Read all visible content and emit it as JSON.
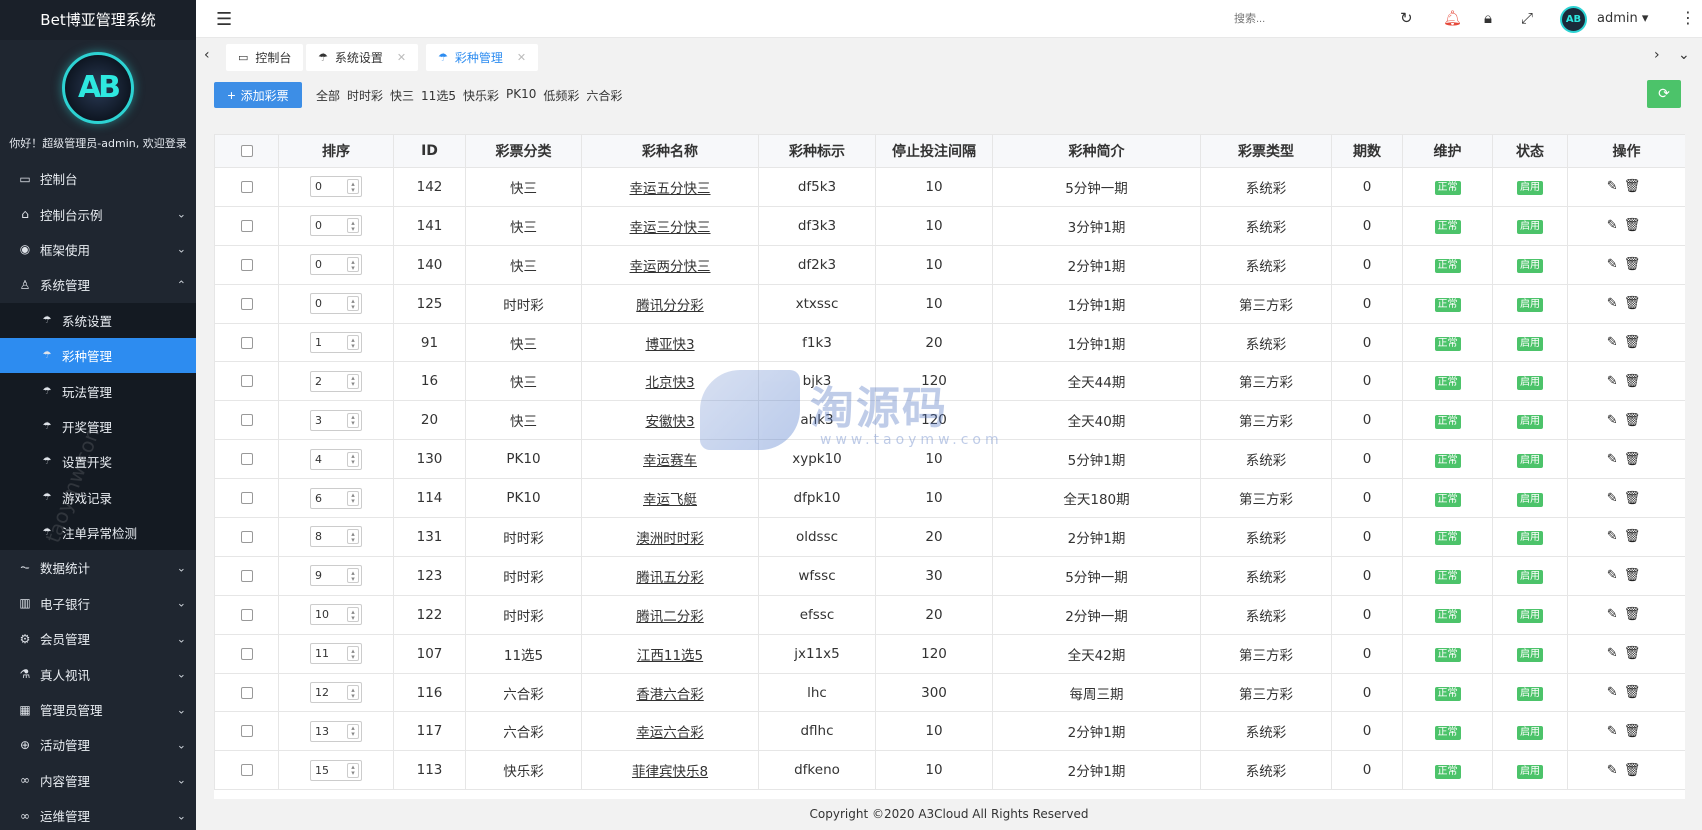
{
  "app": {
    "title": "Bet博亚管理系统",
    "welcome": "你好！超级管理员-admin, 欢迎登录",
    "logo_text": "AB"
  },
  "sidebar": {
    "items": [
      {
        "label": "控制台",
        "icon": "monitor-icon",
        "glyph": "▭",
        "chevron": "",
        "sub": false,
        "active": false
      },
      {
        "label": "控制台示例",
        "icon": "home-icon",
        "glyph": "⌂",
        "chevron": "⌄",
        "sub": false,
        "active": false
      },
      {
        "label": "框架使用",
        "icon": "badge-icon",
        "glyph": "◉",
        "chevron": "⌄",
        "sub": false,
        "active": false
      },
      {
        "label": "系统管理",
        "icon": "user-icon",
        "glyph": "♙",
        "chevron": "⌃",
        "sub": false,
        "active": false
      },
      {
        "label": "系统设置",
        "icon": "umbrella-icon",
        "glyph": "☂",
        "chevron": "",
        "sub": true,
        "active": false
      },
      {
        "label": "彩种管理",
        "icon": "umbrella-icon",
        "glyph": "☂",
        "chevron": "",
        "sub": true,
        "active": true
      },
      {
        "label": "玩法管理",
        "icon": "umbrella-icon",
        "glyph": "☂",
        "chevron": "",
        "sub": true,
        "active": false
      },
      {
        "label": "开奖管理",
        "icon": "umbrella-icon",
        "glyph": "☂",
        "chevron": "",
        "sub": true,
        "active": false
      },
      {
        "label": "设置开奖",
        "icon": "umbrella-icon",
        "glyph": "☂",
        "chevron": "",
        "sub": true,
        "active": false
      },
      {
        "label": "游戏记录",
        "icon": "umbrella-icon",
        "glyph": "☂",
        "chevron": "",
        "sub": true,
        "active": false
      },
      {
        "label": "注单异常检测",
        "icon": "umbrella-icon",
        "glyph": "☂",
        "chevron": "",
        "sub": true,
        "active": false
      },
      {
        "label": "数据统计",
        "icon": "chart-icon",
        "glyph": "⏦",
        "chevron": "⌄",
        "sub": false,
        "active": false
      },
      {
        "label": "电子银行",
        "icon": "book-icon",
        "glyph": "▥",
        "chevron": "⌄",
        "sub": false,
        "active": false
      },
      {
        "label": "会员管理",
        "icon": "gear-icon",
        "glyph": "⚙",
        "chevron": "⌄",
        "sub": false,
        "active": false
      },
      {
        "label": "真人视讯",
        "icon": "flask-icon",
        "glyph": "⚗",
        "chevron": "⌄",
        "sub": false,
        "active": false
      },
      {
        "label": "管理员管理",
        "icon": "grid-icon",
        "glyph": "▦",
        "chevron": "⌄",
        "sub": false,
        "active": false
      },
      {
        "label": "活动管理",
        "icon": "plus-circle-icon",
        "glyph": "⊕",
        "chevron": "⌄",
        "sub": false,
        "active": false
      },
      {
        "label": "内容管理",
        "icon": "link-icon",
        "glyph": "∞",
        "chevron": "⌄",
        "sub": false,
        "active": false
      },
      {
        "label": "运维管理",
        "icon": "link-icon",
        "glyph": "∞",
        "chevron": "⌄",
        "sub": false,
        "active": false
      }
    ],
    "watermark": "taoymw.com"
  },
  "header": {
    "search_placeholder": "搜索...",
    "user": "admin"
  },
  "tabs": [
    {
      "label": "控制台",
      "icon": "monitor-icon",
      "glyph": "▭",
      "closable": false,
      "active": false
    },
    {
      "label": "系统设置",
      "icon": "umbrella-icon",
      "glyph": "☂",
      "closable": true,
      "active": false
    },
    {
      "label": "彩种管理",
      "icon": "umbrella-icon",
      "glyph": "☂",
      "closable": true,
      "active": true
    }
  ],
  "toolbar": {
    "add_label": "添加彩票",
    "filters": [
      "全部",
      "时时彩",
      "快三",
      "11选5",
      "快乐彩",
      "PK10",
      "低频彩",
      "六合彩"
    ]
  },
  "table": {
    "columns": [
      "",
      "排序",
      "ID",
      "彩票分类",
      "彩种名称",
      "彩种标示",
      "停止投注间隔",
      "彩种简介",
      "彩票类型",
      "期数",
      "维护",
      "状态",
      "操作"
    ],
    "rows": [
      {
        "sort": "0",
        "id": "142",
        "cat": "快三",
        "name": "幸运五分快三",
        "code": "df5k3",
        "stop": "10",
        "desc": "5分钟一期",
        "type": "系统彩",
        "periods": "0",
        "maint": "正常",
        "status": "启用"
      },
      {
        "sort": "0",
        "id": "141",
        "cat": "快三",
        "name": "幸运三分快三",
        "code": "df3k3",
        "stop": "10",
        "desc": "3分钟1期",
        "type": "系统彩",
        "periods": "0",
        "maint": "正常",
        "status": "启用"
      },
      {
        "sort": "0",
        "id": "140",
        "cat": "快三",
        "name": "幸运两分快三",
        "code": "df2k3",
        "stop": "10",
        "desc": "2分钟1期",
        "type": "系统彩",
        "periods": "0",
        "maint": "正常",
        "status": "启用"
      },
      {
        "sort": "0",
        "id": "125",
        "cat": "时时彩",
        "name": "腾讯分分彩",
        "code": "xtxssc",
        "stop": "10",
        "desc": "1分钟1期",
        "type": "第三方彩",
        "periods": "0",
        "maint": "正常",
        "status": "启用"
      },
      {
        "sort": "1",
        "id": "91",
        "cat": "快三",
        "name": "博亚快3",
        "code": "f1k3",
        "stop": "20",
        "desc": "1分钟1期",
        "type": "系统彩",
        "periods": "0",
        "maint": "正常",
        "status": "启用"
      },
      {
        "sort": "2",
        "id": "16",
        "cat": "快三",
        "name": "北京快3",
        "code": "bjk3",
        "stop": "120",
        "desc": "全天44期",
        "type": "第三方彩",
        "periods": "0",
        "maint": "正常",
        "status": "启用"
      },
      {
        "sort": "3",
        "id": "20",
        "cat": "快三",
        "name": "安徽快3",
        "code": "ahk3",
        "stop": "120",
        "desc": "全天40期",
        "type": "第三方彩",
        "periods": "0",
        "maint": "正常",
        "status": "启用"
      },
      {
        "sort": "4",
        "id": "130",
        "cat": "PK10",
        "name": "幸运赛车",
        "code": "xypk10",
        "stop": "10",
        "desc": "5分钟1期",
        "type": "系统彩",
        "periods": "0",
        "maint": "正常",
        "status": "启用"
      },
      {
        "sort": "6",
        "id": "114",
        "cat": "PK10",
        "name": "幸运飞艇",
        "code": "dfpk10",
        "stop": "10",
        "desc": "全天180期",
        "type": "第三方彩",
        "periods": "0",
        "maint": "正常",
        "status": "启用"
      },
      {
        "sort": "8",
        "id": "131",
        "cat": "时时彩",
        "name": "澳洲时时彩",
        "code": "oldssc",
        "stop": "20",
        "desc": "2分钟1期",
        "type": "系统彩",
        "periods": "0",
        "maint": "正常",
        "status": "启用"
      },
      {
        "sort": "9",
        "id": "123",
        "cat": "时时彩",
        "name": "腾讯五分彩",
        "code": "wfssc",
        "stop": "30",
        "desc": "5分钟一期",
        "type": "系统彩",
        "periods": "0",
        "maint": "正常",
        "status": "启用"
      },
      {
        "sort": "10",
        "id": "122",
        "cat": "时时彩",
        "name": "腾讯二分彩",
        "code": "efssc",
        "stop": "20",
        "desc": "2分钟一期",
        "type": "系统彩",
        "periods": "0",
        "maint": "正常",
        "status": "启用"
      },
      {
        "sort": "11",
        "id": "107",
        "cat": "11选5",
        "name": "江西11选5",
        "code": "jx11x5",
        "stop": "120",
        "desc": "全天42期",
        "type": "第三方彩",
        "periods": "0",
        "maint": "正常",
        "status": "启用"
      },
      {
        "sort": "12",
        "id": "116",
        "cat": "六合彩",
        "name": "香港六合彩",
        "code": "lhc",
        "stop": "300",
        "desc": "每周三期",
        "type": "第三方彩",
        "periods": "0",
        "maint": "正常",
        "status": "启用"
      },
      {
        "sort": "13",
        "id": "117",
        "cat": "六合彩",
        "name": "幸运六合彩",
        "code": "dflhc",
        "stop": "10",
        "desc": "2分钟1期",
        "type": "系统彩",
        "periods": "0",
        "maint": "正常",
        "status": "启用"
      },
      {
        "sort": "15",
        "id": "113",
        "cat": "快乐彩",
        "name": "菲律宾快乐8",
        "code": "dfkeno",
        "stop": "10",
        "desc": "2分钟1期",
        "type": "系统彩",
        "periods": "0",
        "maint": "正常",
        "status": "启用"
      }
    ]
  },
  "footer": {
    "copyright": "Copyright ©2020 A3Cloud All Rights Reserved"
  },
  "watermark": {
    "text": "淘源码",
    "sub": "www.taoymw.com"
  },
  "colors": {
    "sidebar_bg": "#1f2630",
    "accent": "#2d8cf0",
    "success": "#4cc36a"
  }
}
